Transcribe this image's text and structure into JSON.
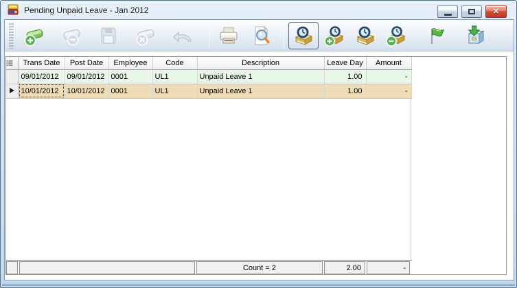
{
  "window": {
    "title": "Pending Unpaid Leave - Jan 2012",
    "controls": [
      {
        "name": "minimize"
      },
      {
        "name": "maximize"
      },
      {
        "name": "close"
      }
    ]
  },
  "icons": {
    "close_glyph": "✕"
  },
  "toolbar": {
    "buttons": [
      {
        "name": "add-record",
        "enabled": true,
        "selected": false
      },
      {
        "name": "delete-record",
        "enabled": false,
        "selected": false
      },
      {
        "name": "save-record",
        "enabled": false,
        "selected": false
      },
      {
        "name": "cancel-record",
        "enabled": false,
        "selected": false
      },
      {
        "name": "undo",
        "enabled": false,
        "selected": false
      },
      {
        "name": "print",
        "enabled": true,
        "selected": false
      },
      {
        "name": "preview",
        "enabled": true,
        "selected": false
      },
      {
        "name": "pending-leave",
        "enabled": true,
        "selected": true
      },
      {
        "name": "add-leave",
        "enabled": true,
        "selected": false
      },
      {
        "name": "view-leave",
        "enabled": true,
        "selected": false
      },
      {
        "name": "remove-leave",
        "enabled": true,
        "selected": false
      },
      {
        "name": "flag",
        "enabled": true,
        "selected": false
      },
      {
        "name": "post",
        "enabled": true,
        "selected": false
      }
    ]
  },
  "grid": {
    "columns": [
      "",
      "Trans Date",
      "Post Date",
      "Employee",
      "Code",
      "Description",
      "Leave Day",
      "Amount"
    ],
    "rows": [
      {
        "trans_date": "09/01/2012",
        "post_date": "09/01/2012",
        "employee": "0001",
        "code": "UL1",
        "description": "Unpaid Leave 1",
        "leave_day": "1.00",
        "amount": "-"
      },
      {
        "trans_date": "10/01/2012",
        "post_date": "10/01/2012",
        "employee": "0001",
        "code": "UL1",
        "description": "Unpaid Leave 1",
        "leave_day": "1.00",
        "amount": "-"
      }
    ],
    "current_row_index": 1,
    "footer": {
      "count": "Count = 2",
      "leave_day_total": "2.00",
      "amount_total": "-"
    }
  },
  "colors": {
    "row_normal": "#e9f7e9",
    "row_current": "#eedcb7",
    "titlebar": "#d4e3f4",
    "accent_green": "#4db34a",
    "close_button": "#d14a36"
  }
}
